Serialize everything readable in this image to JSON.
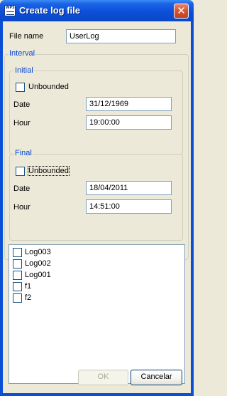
{
  "window": {
    "title": "Create log file",
    "app_icon_text": "WPS"
  },
  "form": {
    "file_name_label": "File name",
    "file_name_value": "UserLog"
  },
  "interval": {
    "legend": "Interval",
    "initial": {
      "legend": "Initial",
      "unbounded_label": "Unbounded",
      "unbounded_checked": false,
      "date_label": "Date",
      "date_value": "31/12/1969",
      "hour_label": "Hour",
      "hour_value": "19:00:00"
    },
    "final": {
      "legend": "Final",
      "unbounded_label": "Unbounded",
      "unbounded_checked": false,
      "date_label": "Date",
      "date_value": "18/04/2011",
      "hour_label": "Hour",
      "hour_value": "14:51:00"
    }
  },
  "logs": {
    "items": [
      {
        "label": "Log003",
        "checked": false
      },
      {
        "label": "Log002",
        "checked": false
      },
      {
        "label": "Log001",
        "checked": false
      },
      {
        "label": "f1",
        "checked": false
      },
      {
        "label": "f2",
        "checked": false
      }
    ]
  },
  "buttons": {
    "ok_label": "OK",
    "ok_enabled": false,
    "cancel_label": "Cancelar"
  },
  "colors": {
    "titlebar": "#0a4fd6",
    "dialog_bg": "#ece9d8",
    "group_title": "#0046d5",
    "close_button": "#d7532f"
  }
}
